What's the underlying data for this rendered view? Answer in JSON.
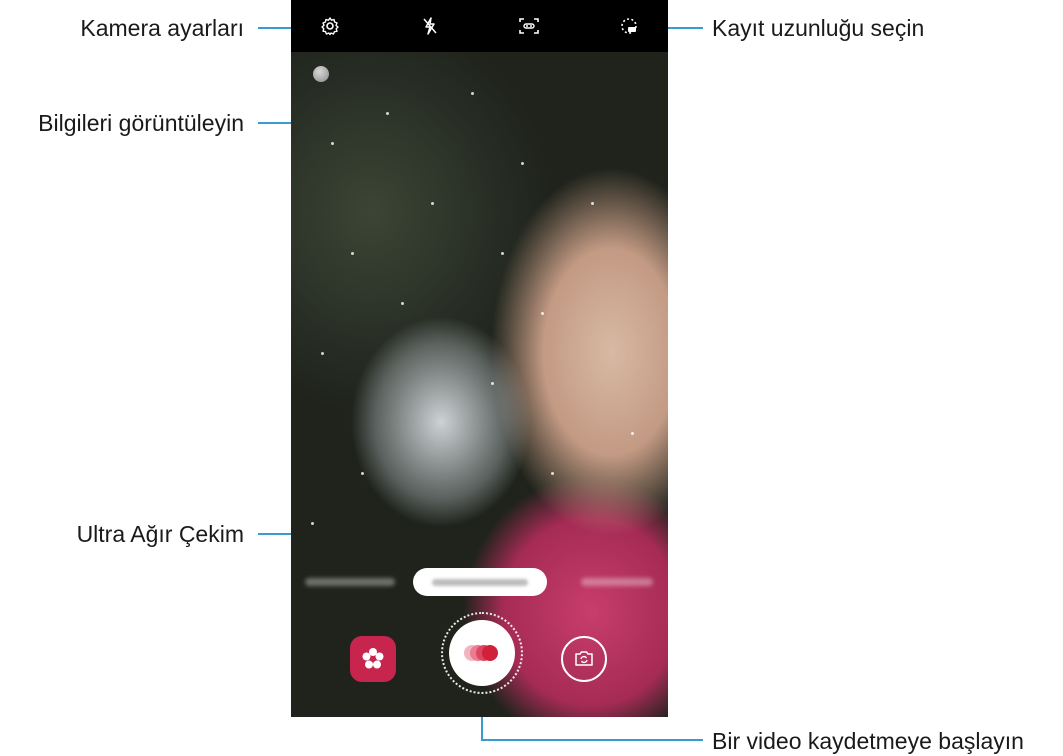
{
  "callouts": {
    "camera_settings": "Kamera ayarları",
    "view_info": "Bilgileri görüntüleyin",
    "super_slow_mo": "Ultra Ağır Çekim",
    "record_length": "Kayıt uzunluğu seçin",
    "start_recording": "Bir video kaydetmeye başlayın"
  },
  "topbar": {
    "icons": [
      "gear-icon",
      "flash-off-icon",
      "motion-detect-icon",
      "record-length-icon"
    ]
  },
  "bottom_controls": {
    "icons": [
      "effects-icon",
      "record-icon",
      "switch-camera-icon"
    ]
  },
  "colors": {
    "callout_line": "#3a9bd4",
    "effects_button": "#c7254e",
    "record_red": "#d0203a"
  }
}
